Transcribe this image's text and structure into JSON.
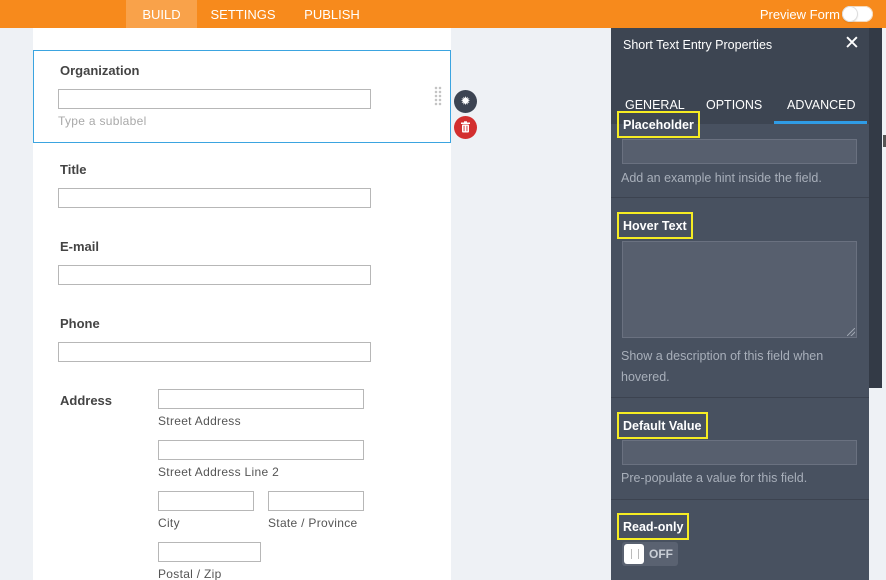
{
  "topbar": {
    "tabs": [
      {
        "label": "BUILD",
        "active": true
      },
      {
        "label": "SETTINGS",
        "active": false
      },
      {
        "label": "PUBLISH",
        "active": false
      }
    ],
    "preview_label": "Preview Form",
    "preview_on": false,
    "accent_color": "#f78a1c"
  },
  "form": {
    "organization": {
      "label": "Organization",
      "sublabel_placeholder": "Type a sublabel"
    },
    "title": {
      "label": "Title"
    },
    "email": {
      "label": "E-mail"
    },
    "phone": {
      "label": "Phone"
    },
    "address": {
      "label": "Address",
      "street": "Street Address",
      "street2": "Street Address Line 2",
      "city": "City",
      "state": "State / Province",
      "postal": "Postal / Zip"
    }
  },
  "panel": {
    "title": "Short Text Entry Properties",
    "tabs": [
      {
        "label": "GENERAL",
        "active": false
      },
      {
        "label": "OPTIONS",
        "active": false
      },
      {
        "label": "ADVANCED",
        "active": true
      }
    ],
    "placeholder": {
      "label": "Placeholder",
      "value": "",
      "help": "Add an example hint inside the field."
    },
    "hover_text": {
      "label": "Hover Text",
      "value": "",
      "help": "Show a description of this field when hovered."
    },
    "default_value": {
      "label": "Default Value",
      "value": "",
      "help": "Pre-populate a value for this field."
    },
    "read_only": {
      "label": "Read-only",
      "state": "OFF"
    },
    "highlight_color": "#f6ec23",
    "tab_indicator_color": "#2f9ce6"
  }
}
